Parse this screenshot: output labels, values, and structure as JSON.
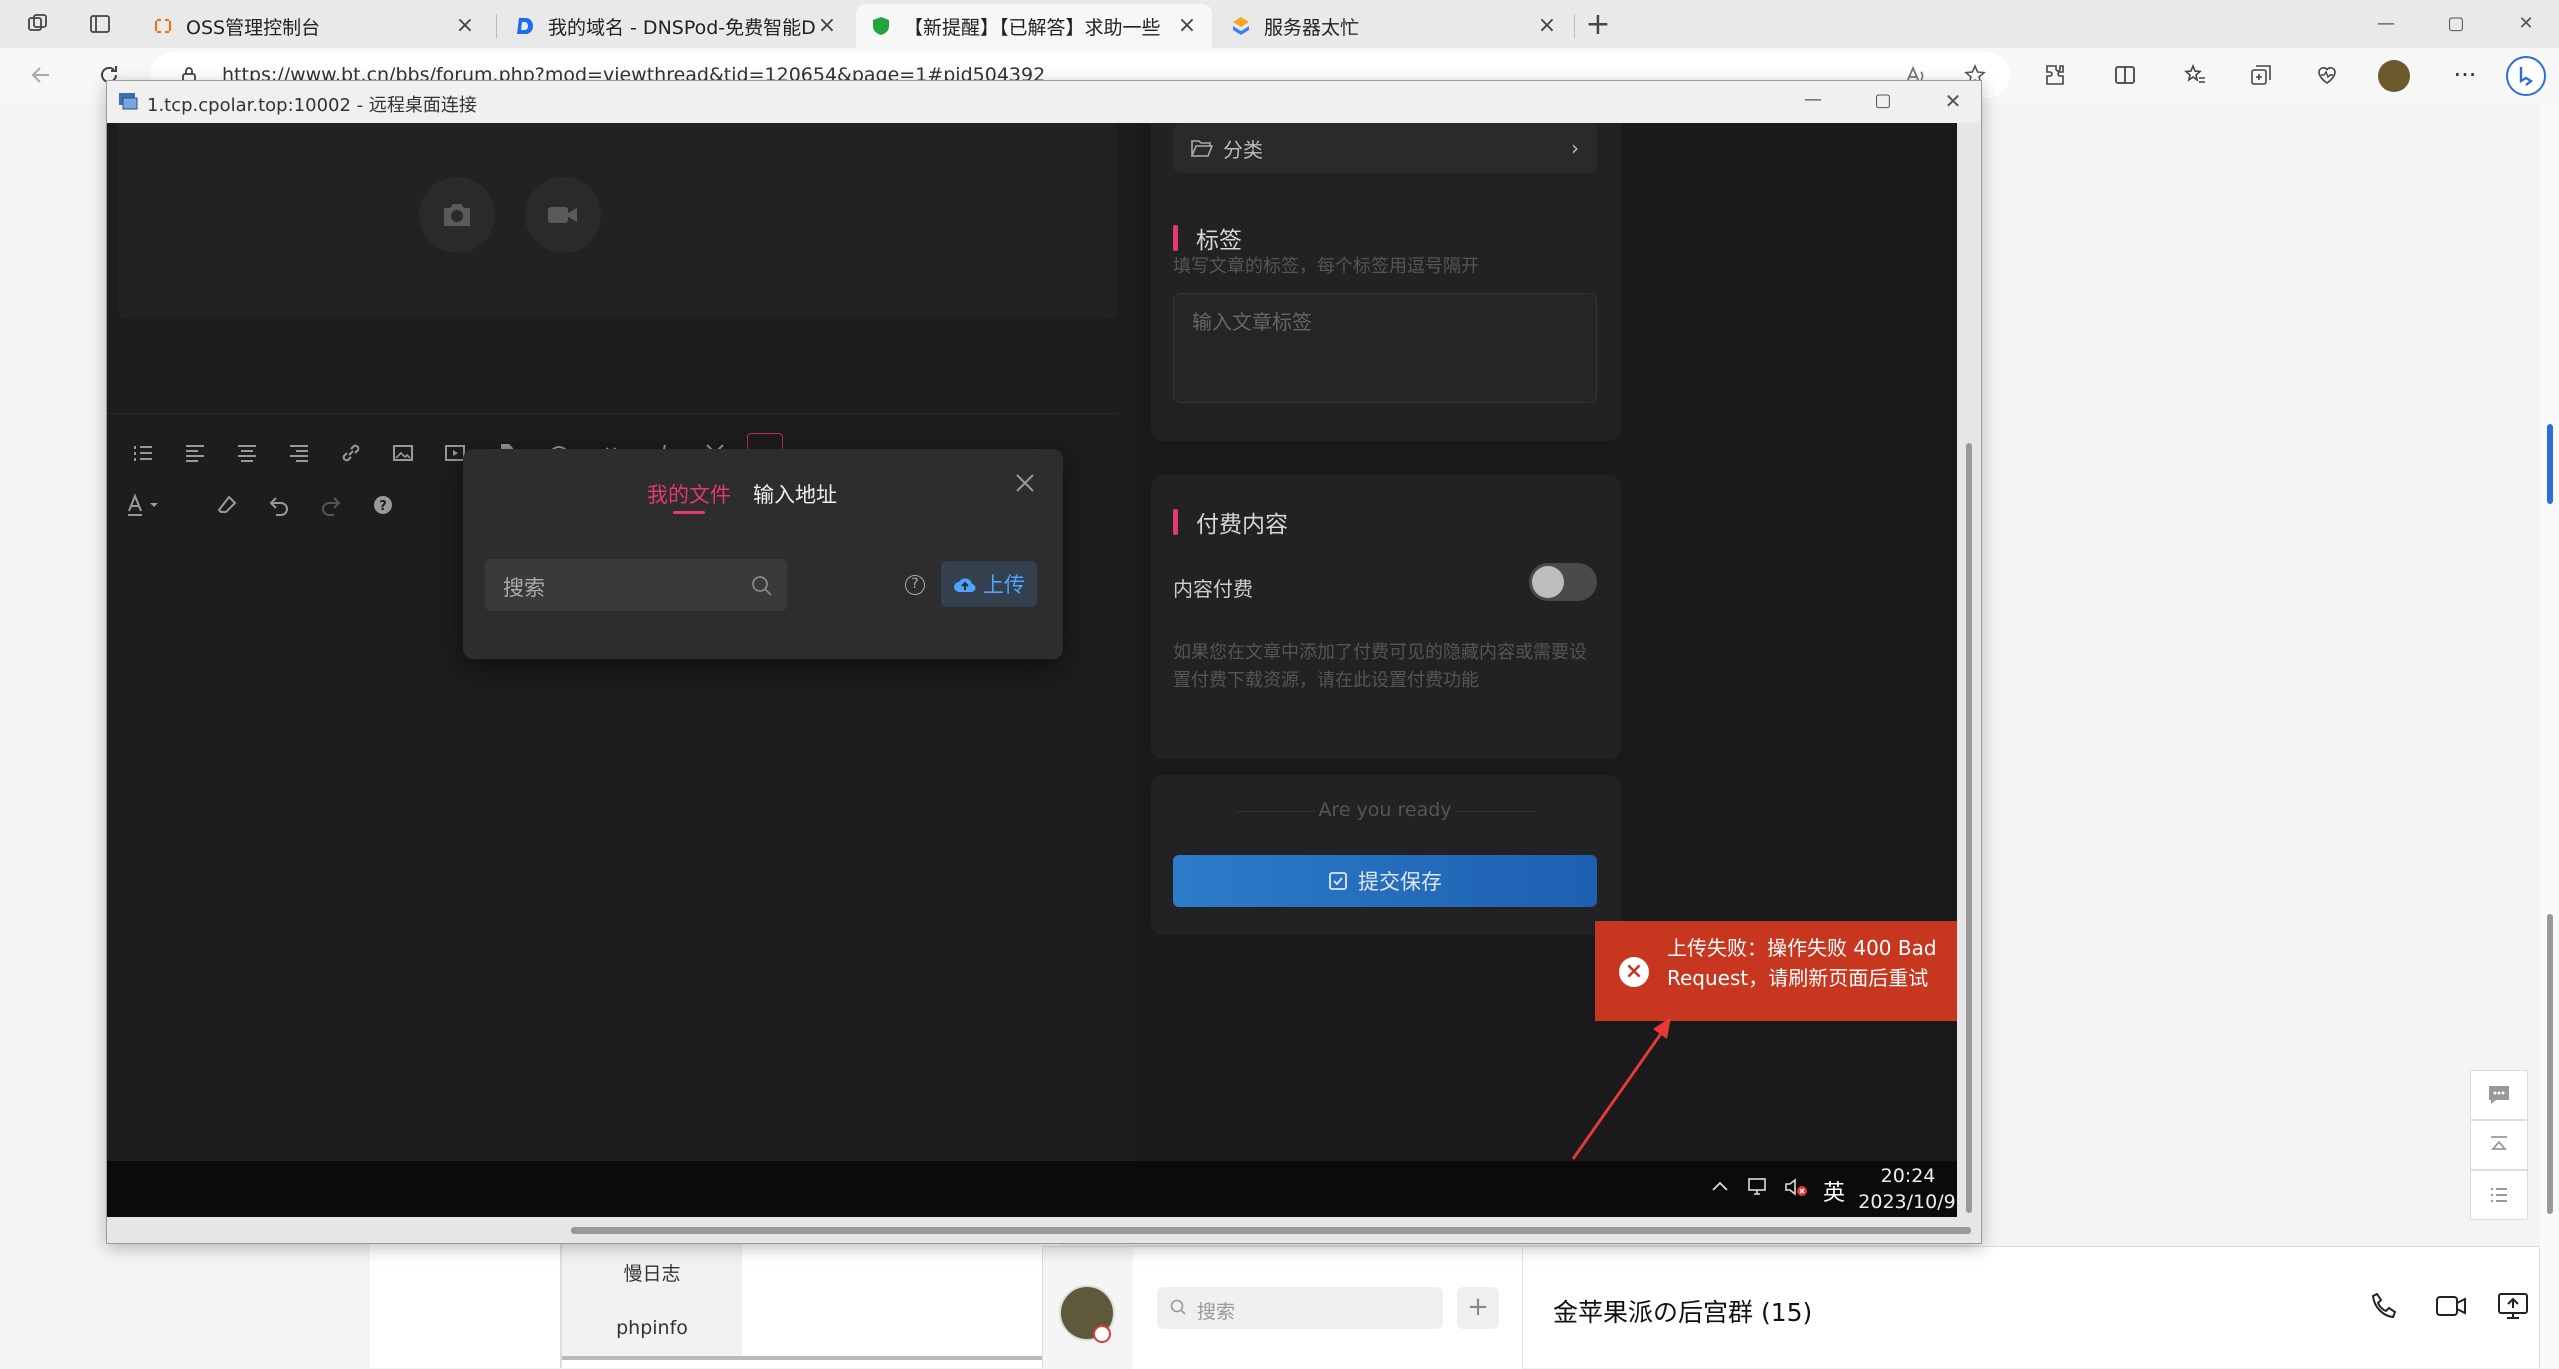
{
  "browser": {
    "tabs": [
      {
        "title": "OSS管理控制台",
        "active": false
      },
      {
        "title": "我的域名 - DNSPod-免费智能DN",
        "active": false
      },
      {
        "title": "【新提醒】【已解答】求助一些",
        "active": true
      },
      {
        "title": "服务器太忙",
        "active": false
      }
    ],
    "url": "https://www.bt.cn/bbs/forum.php?mod=viewthread&tid=120654&page=1#pid504392",
    "new_tab": "+"
  },
  "rdp": {
    "title": "1.tcp.cpolar.top:10002 - 远程桌面连接"
  },
  "editor": {
    "category_label": "分类",
    "tags_title": "标签",
    "tags_hint": "填写文章的标签，每个标签用逗号隔开",
    "tags_placeholder": "输入文章标签",
    "paid_title": "付费内容",
    "paid_toggle_label": "内容付费",
    "paid_hint": "如果您在文章中添加了付费可见的隐藏内容或需要设置付费下载资源，请在此设置付费功能",
    "ready_text": "Are you ready",
    "submit_label": "提交保存"
  },
  "file_modal": {
    "tab_my_files": "我的文件",
    "tab_url": "输入地址",
    "search_placeholder": "搜索",
    "upload_label": "上传",
    "help_icon": "?"
  },
  "toast": {
    "message": "上传失败：操作失败 400 Bad Request，请刷新页面后重试",
    "icon": "×"
  },
  "remote_taskbar": {
    "ime": "英",
    "time": "20:24",
    "date": "2023/10/9"
  },
  "forum_sidebar": {
    "items": [
      "慢日志",
      "phpinfo"
    ]
  },
  "qq": {
    "search_placeholder": "搜索",
    "add": "+",
    "group_title": "金苹果派の后宫群 (15)"
  },
  "colors": {
    "accent_pink": "#e4386e",
    "error_red": "#c7361e",
    "submit_blue": "#2c7cc9",
    "link_blue": "#4fa3ff"
  }
}
